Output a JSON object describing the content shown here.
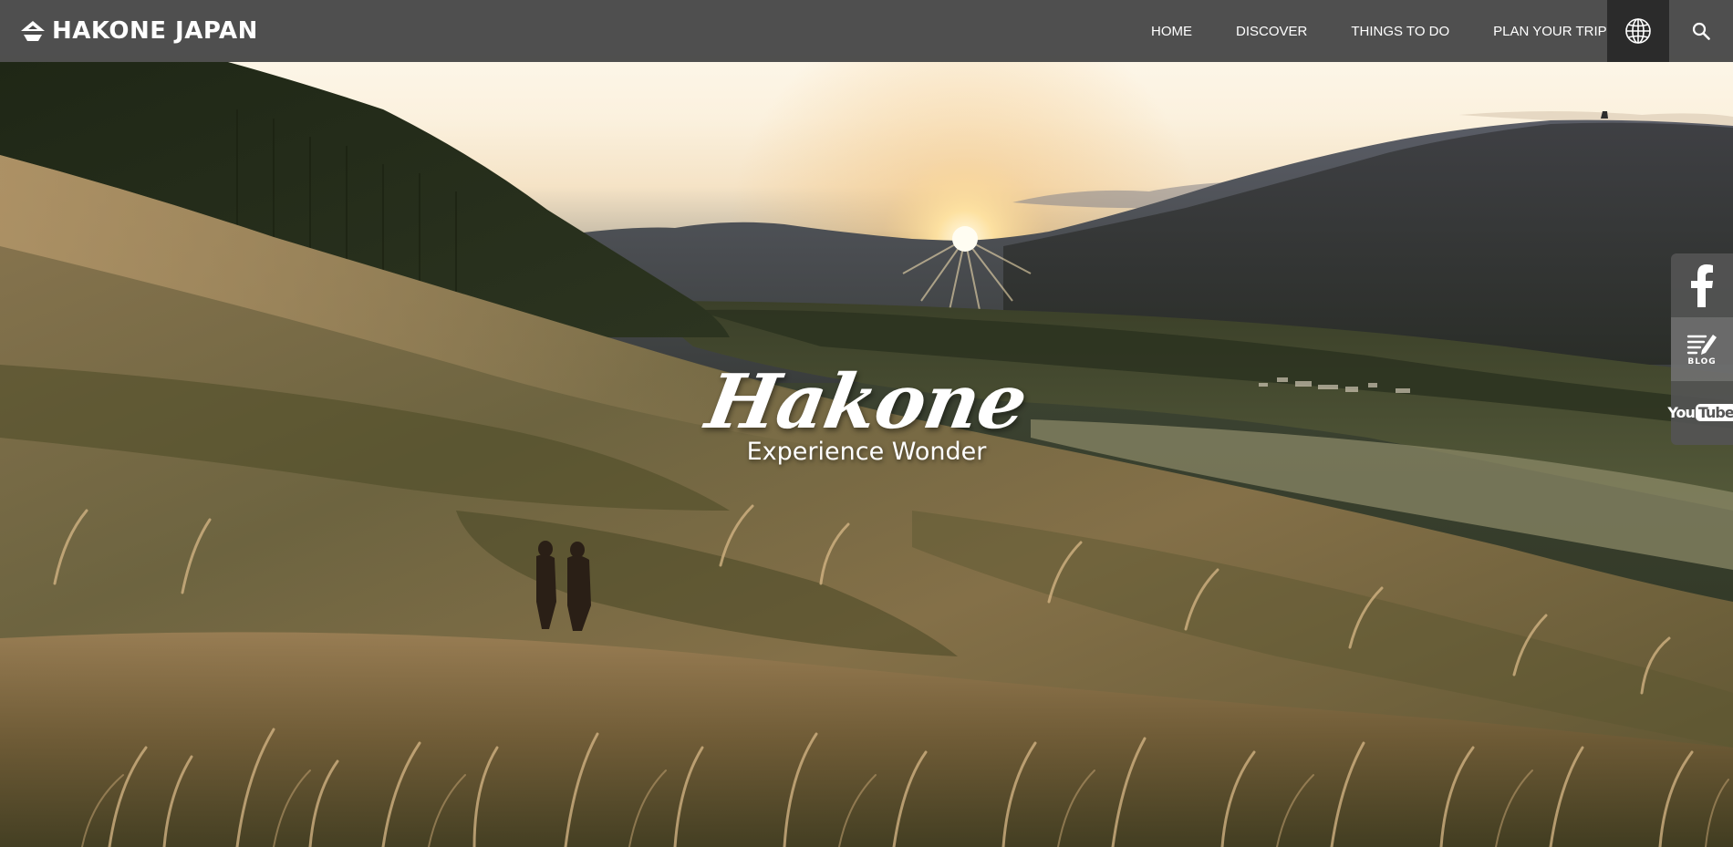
{
  "brand": {
    "name": "HAKONE JAPAN",
    "logo_icon": "mountain-logo-icon"
  },
  "nav": {
    "items": [
      {
        "label": "HOME"
      },
      {
        "label": "DISCOVER"
      },
      {
        "label": "THINGS TO DO"
      },
      {
        "label": "PLAN YOUR TRIP"
      }
    ],
    "language_icon": "globe-icon",
    "search_icon": "search-icon"
  },
  "hero": {
    "title": "Hakone",
    "subtitle": "Experience Wonder",
    "image": "sunset-over-pampas-grass-hillside"
  },
  "social": {
    "facebook_icon": "facebook-icon",
    "blog_label": "BLOG",
    "blog_icon": "blog-icon",
    "youtube_you": "You",
    "youtube_tube": "Tube"
  },
  "colors": {
    "topbar": "#484848",
    "language_button": "#2b2b2b",
    "text": "#ffffff"
  }
}
